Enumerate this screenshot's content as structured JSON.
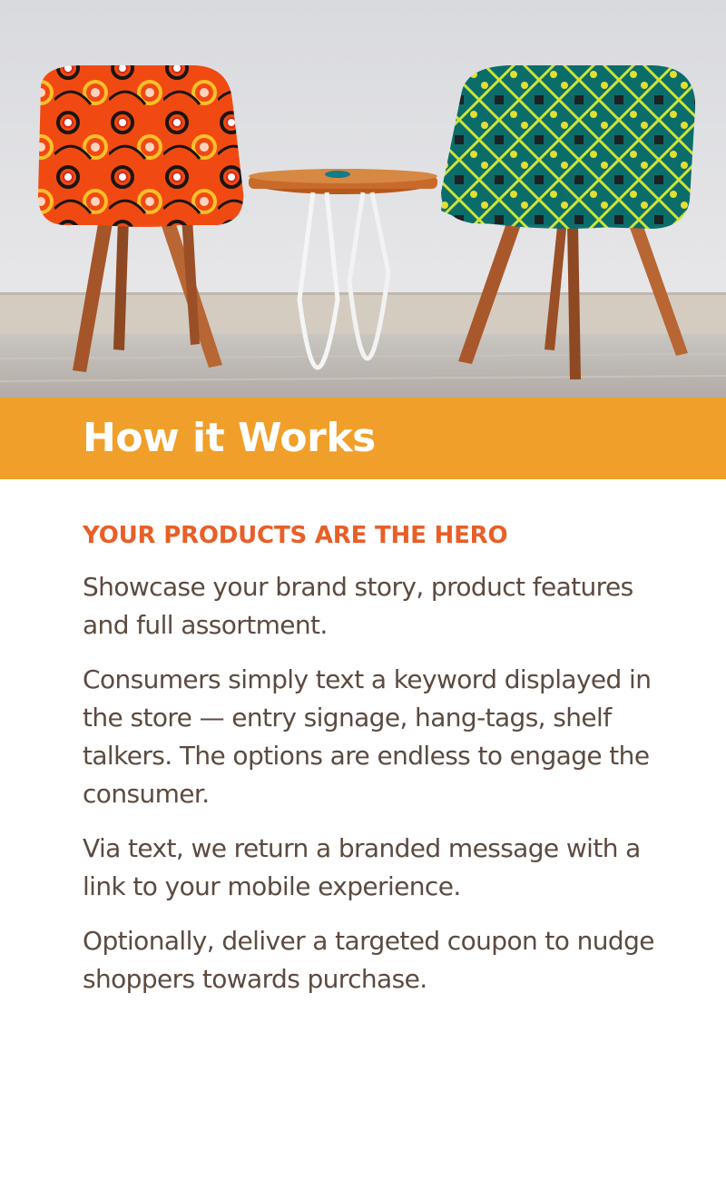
{
  "hero": {
    "image_description": "Two patterned armchairs beside a small round wooden side table with white hairpin legs"
  },
  "header": {
    "title": "How it Works"
  },
  "main": {
    "heading": "YOUR PRODUCTS ARE THE HERO",
    "paragraphs": [
      "Showcase your brand story, product features and full assortment.",
      "Consumers simply text a keyword displayed in the store —  entry signage, hang-tags, shelf talkers. The options are endless to engage the consumer.",
      "Via text, we return a branded message with a link to your mobile experience.",
      "Optionally, deliver a targeted coupon to nudge shoppers towards purchase."
    ]
  },
  "colors": {
    "banner": "#f0a02a",
    "heading": "#e85f28",
    "body_text": "#5c4a40",
    "banner_text": "#ffffff"
  }
}
